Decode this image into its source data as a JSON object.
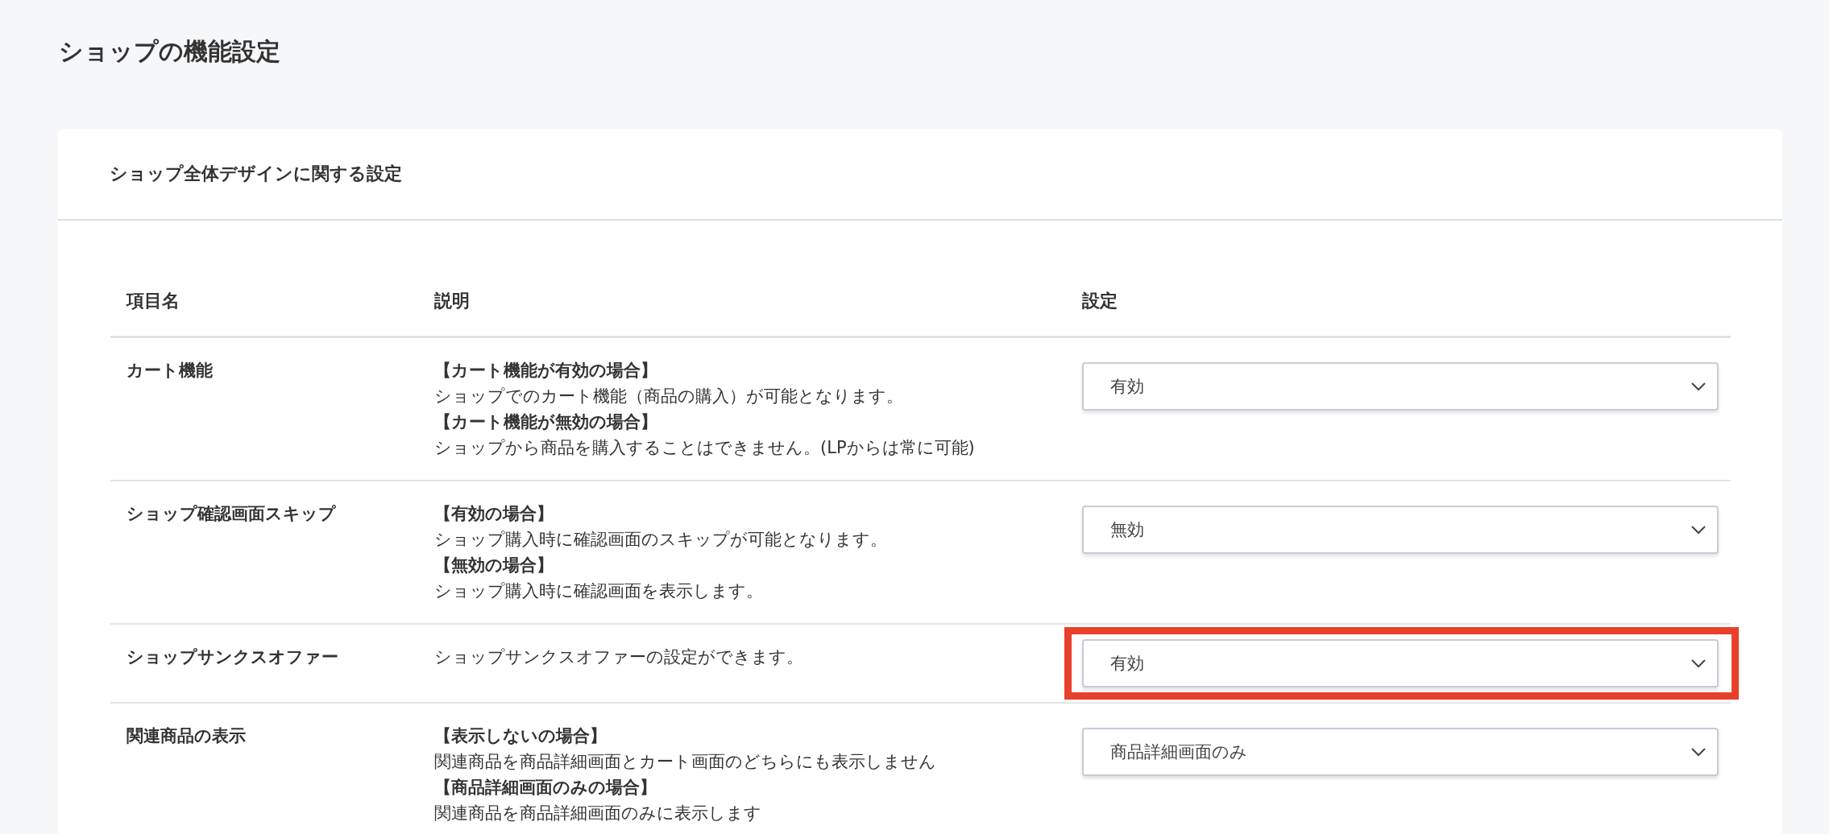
{
  "page_title": "ショップの機能設定",
  "card": {
    "title": "ショップ全体デザインに関する設定"
  },
  "table": {
    "columns": [
      "項目名",
      "説明",
      "設定"
    ],
    "rows": [
      {
        "name": "カート機能",
        "highlighted": false,
        "description": [
          {
            "text": "【カート機能が有効の場合】",
            "bold": true
          },
          {
            "text": "ショップでのカート機能（商品の購入）が可能となります。",
            "bold": false
          },
          {
            "text": "【カート機能が無効の場合】",
            "bold": true
          },
          {
            "text": "ショップから商品を購入することはできません。(LPからは常に可能)",
            "bold": false
          }
        ],
        "setting": "有効"
      },
      {
        "name": "ショップ確認画面スキップ",
        "highlighted": false,
        "description": [
          {
            "text": "【有効の場合】",
            "bold": true
          },
          {
            "text": "ショップ購入時に確認画面のスキップが可能となります。",
            "bold": false
          },
          {
            "text": "【無効の場合】",
            "bold": true
          },
          {
            "text": "ショップ購入時に確認画面を表示します。",
            "bold": false
          }
        ],
        "setting": "無効"
      },
      {
        "name": "ショップサンクスオファー",
        "highlighted": true,
        "description": [
          {
            "text": "ショップサンクスオファーの設定ができます。",
            "bold": false
          }
        ],
        "setting": "有効"
      },
      {
        "name": "関連商品の表示",
        "highlighted": false,
        "description": [
          {
            "text": "【表示しないの場合】",
            "bold": true
          },
          {
            "text": "関連商品を商品詳細画面とカート画面のどちらにも表示しません",
            "bold": false
          },
          {
            "text": "【商品詳細画面のみの場合】",
            "bold": true
          },
          {
            "text": "関連商品を商品詳細画面のみに表示します",
            "bold": false
          }
        ],
        "setting": "商品詳細画面のみ"
      }
    ]
  }
}
